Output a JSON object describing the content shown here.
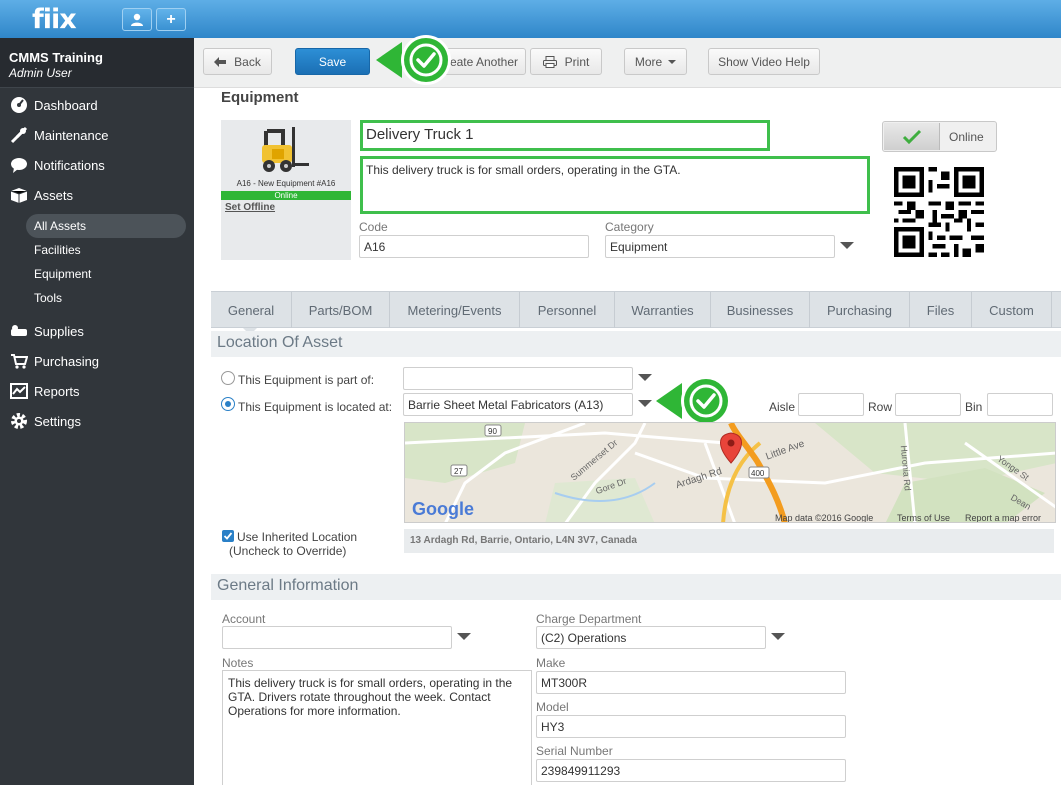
{
  "app": {
    "logo": "fiix",
    "org_name": "CMMS Training",
    "user_role": "Admin User"
  },
  "sidebar": {
    "items": [
      {
        "label": "Dashboard",
        "icon": "dashboard-icon"
      },
      {
        "label": "Maintenance",
        "icon": "tools-icon"
      },
      {
        "label": "Notifications",
        "icon": "chat-bubble-icon"
      },
      {
        "label": "Assets",
        "icon": "box-icon"
      },
      {
        "label": "Supplies",
        "icon": "supplies-icon"
      },
      {
        "label": "Purchasing",
        "icon": "cart-icon"
      },
      {
        "label": "Reports",
        "icon": "chart-icon"
      },
      {
        "label": "Settings",
        "icon": "gear-icon"
      }
    ],
    "asset_subitems": [
      {
        "label": "All Assets",
        "active": true
      },
      {
        "label": "Facilities"
      },
      {
        "label": "Equipment"
      },
      {
        "label": "Tools"
      }
    ]
  },
  "toolbar": {
    "back_label": "Back",
    "save_label": "Save",
    "create_another_label": "eate Another",
    "print_label": "Print",
    "more_label": "More",
    "video_help_label": "Show Video Help"
  },
  "asset": {
    "page_title": "Equipment",
    "card_label": "A16 - New Equipment #A16",
    "status": "Online",
    "set_offline_label": "Set Offline",
    "name": "Delivery Truck 1",
    "description": "This delivery truck is for small orders, operating in the GTA.",
    "code_label": "Code",
    "code": "A16",
    "category_label": "Category",
    "category": "Equipment",
    "online_toggle_label": "Online"
  },
  "tabs": [
    "General",
    "Parts/BOM",
    "Metering/Events",
    "Personnel",
    "Warranties",
    "Businesses",
    "Purchasing",
    "Files",
    "Custom"
  ],
  "location": {
    "section_title": "Location Of Asset",
    "part_of_label": "This Equipment is part of:",
    "part_of_value": "",
    "located_at_label": "This Equipment is located at:",
    "located_at_value": "Barrie Sheet Metal Fabricators (A13)",
    "aisle_label": "Aisle",
    "row_label": "Row",
    "bin_label": "Bin",
    "inherited_label_1": "Use Inherited Location",
    "inherited_label_2": "(Uncheck to Override)",
    "address": "13 Ardagh Rd, Barrie, Ontario, L4N 3V7, Canada",
    "map": {
      "google_label": "Google",
      "map_data": "Map data ©2016 Google",
      "terms": "Terms of Use",
      "report": "Report a map error",
      "road_90": "90",
      "road_27": "27",
      "road_400": "400",
      "street_summerset": "Summerset Dr",
      "street_gore": "Gore Dr",
      "street_ardagh": "Ardagh Rd",
      "street_little": "Little Ave",
      "street_huronia": "Huronia Rd",
      "street_yonge": "Yonge St",
      "street_dean": "Dean"
    }
  },
  "general_info": {
    "section_title": "General Information",
    "account_label": "Account",
    "account_value": "",
    "charge_dept_label": "Charge Department",
    "charge_dept_value": "(C2) Operations",
    "notes_label": "Notes",
    "notes_value": "This delivery truck is for small orders, operating in the GTA. Drivers rotate throughout the week. Contact Operations for more information.",
    "make_label": "Make",
    "make_value": "MT300R",
    "model_label": "Model",
    "model_value": "HY3",
    "serial_label": "Serial Number",
    "serial_value": "239849911293"
  },
  "colors": {
    "accent_blue": "#2a80c7",
    "highlight_green": "#3fbf4c",
    "sidebar_bg": "#31363b",
    "online_green": "#2fb636"
  }
}
